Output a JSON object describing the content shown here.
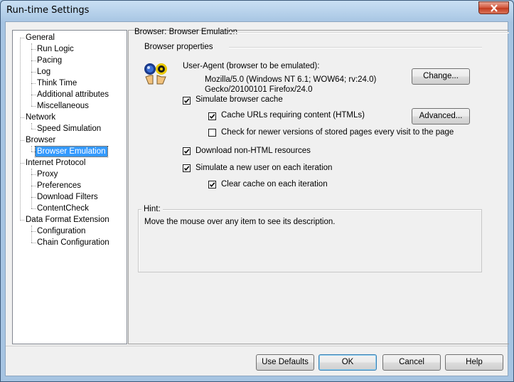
{
  "window": {
    "title": "Run-time Settings"
  },
  "tree": {
    "items": [
      {
        "label": "General",
        "level": 0
      },
      {
        "label": "Run Logic",
        "level": 1
      },
      {
        "label": "Pacing",
        "level": 1
      },
      {
        "label": "Log",
        "level": 1
      },
      {
        "label": "Think Time",
        "level": 1
      },
      {
        "label": "Additional attributes",
        "level": 1
      },
      {
        "label": "Miscellaneous",
        "level": 1
      },
      {
        "label": "Network",
        "level": 0
      },
      {
        "label": "Speed Simulation",
        "level": 1
      },
      {
        "label": "Browser",
        "level": 0
      },
      {
        "label": "Browser Emulation",
        "level": 1,
        "selected": true
      },
      {
        "label": "Internet Protocol",
        "level": 0
      },
      {
        "label": "Proxy",
        "level": 1
      },
      {
        "label": "Preferences",
        "level": 1
      },
      {
        "label": "Download Filters",
        "level": 1
      },
      {
        "label": "ContentCheck",
        "level": 1
      },
      {
        "label": "Data Format Extension",
        "level": 0
      },
      {
        "label": "Configuration",
        "level": 1
      },
      {
        "label": "Chain Configuration",
        "level": 1
      }
    ]
  },
  "panel": {
    "heading": "Browser: Browser Emulation",
    "section_title": "Browser properties",
    "user_agent_label": "User-Agent (browser to be emulated):",
    "user_agent_line1": "Mozilla/5.0 (Windows NT 6.1; WOW64; rv:24.0)",
    "user_agent_line2": "Gecko/20100101 Firefox/24.0",
    "change_button": "Change...",
    "simulate_cache": {
      "label": "Simulate browser cache",
      "checked": true
    },
    "cache_urls": {
      "label": "Cache URLs requiring content (HTMLs)",
      "checked": true
    },
    "advanced_button": "Advanced...",
    "check_newer": {
      "label": "Check for newer versions of stored pages every visit to the page",
      "checked": false
    },
    "download_non_html": {
      "label": "Download non-HTML resources",
      "checked": true
    },
    "simulate_new_user": {
      "label": "Simulate a new user on each iteration",
      "checked": true
    },
    "clear_cache": {
      "label": "Clear cache on each iteration",
      "checked": true
    },
    "hint_title": "Hint:",
    "hint_text": "Move the mouse over any item to see its description."
  },
  "footer": {
    "use_defaults": "Use Defaults",
    "ok": "OK",
    "cancel": "Cancel",
    "help": "Help"
  },
  "colors": {
    "selection": "#3399ff",
    "close_button": "#c23a1e"
  }
}
